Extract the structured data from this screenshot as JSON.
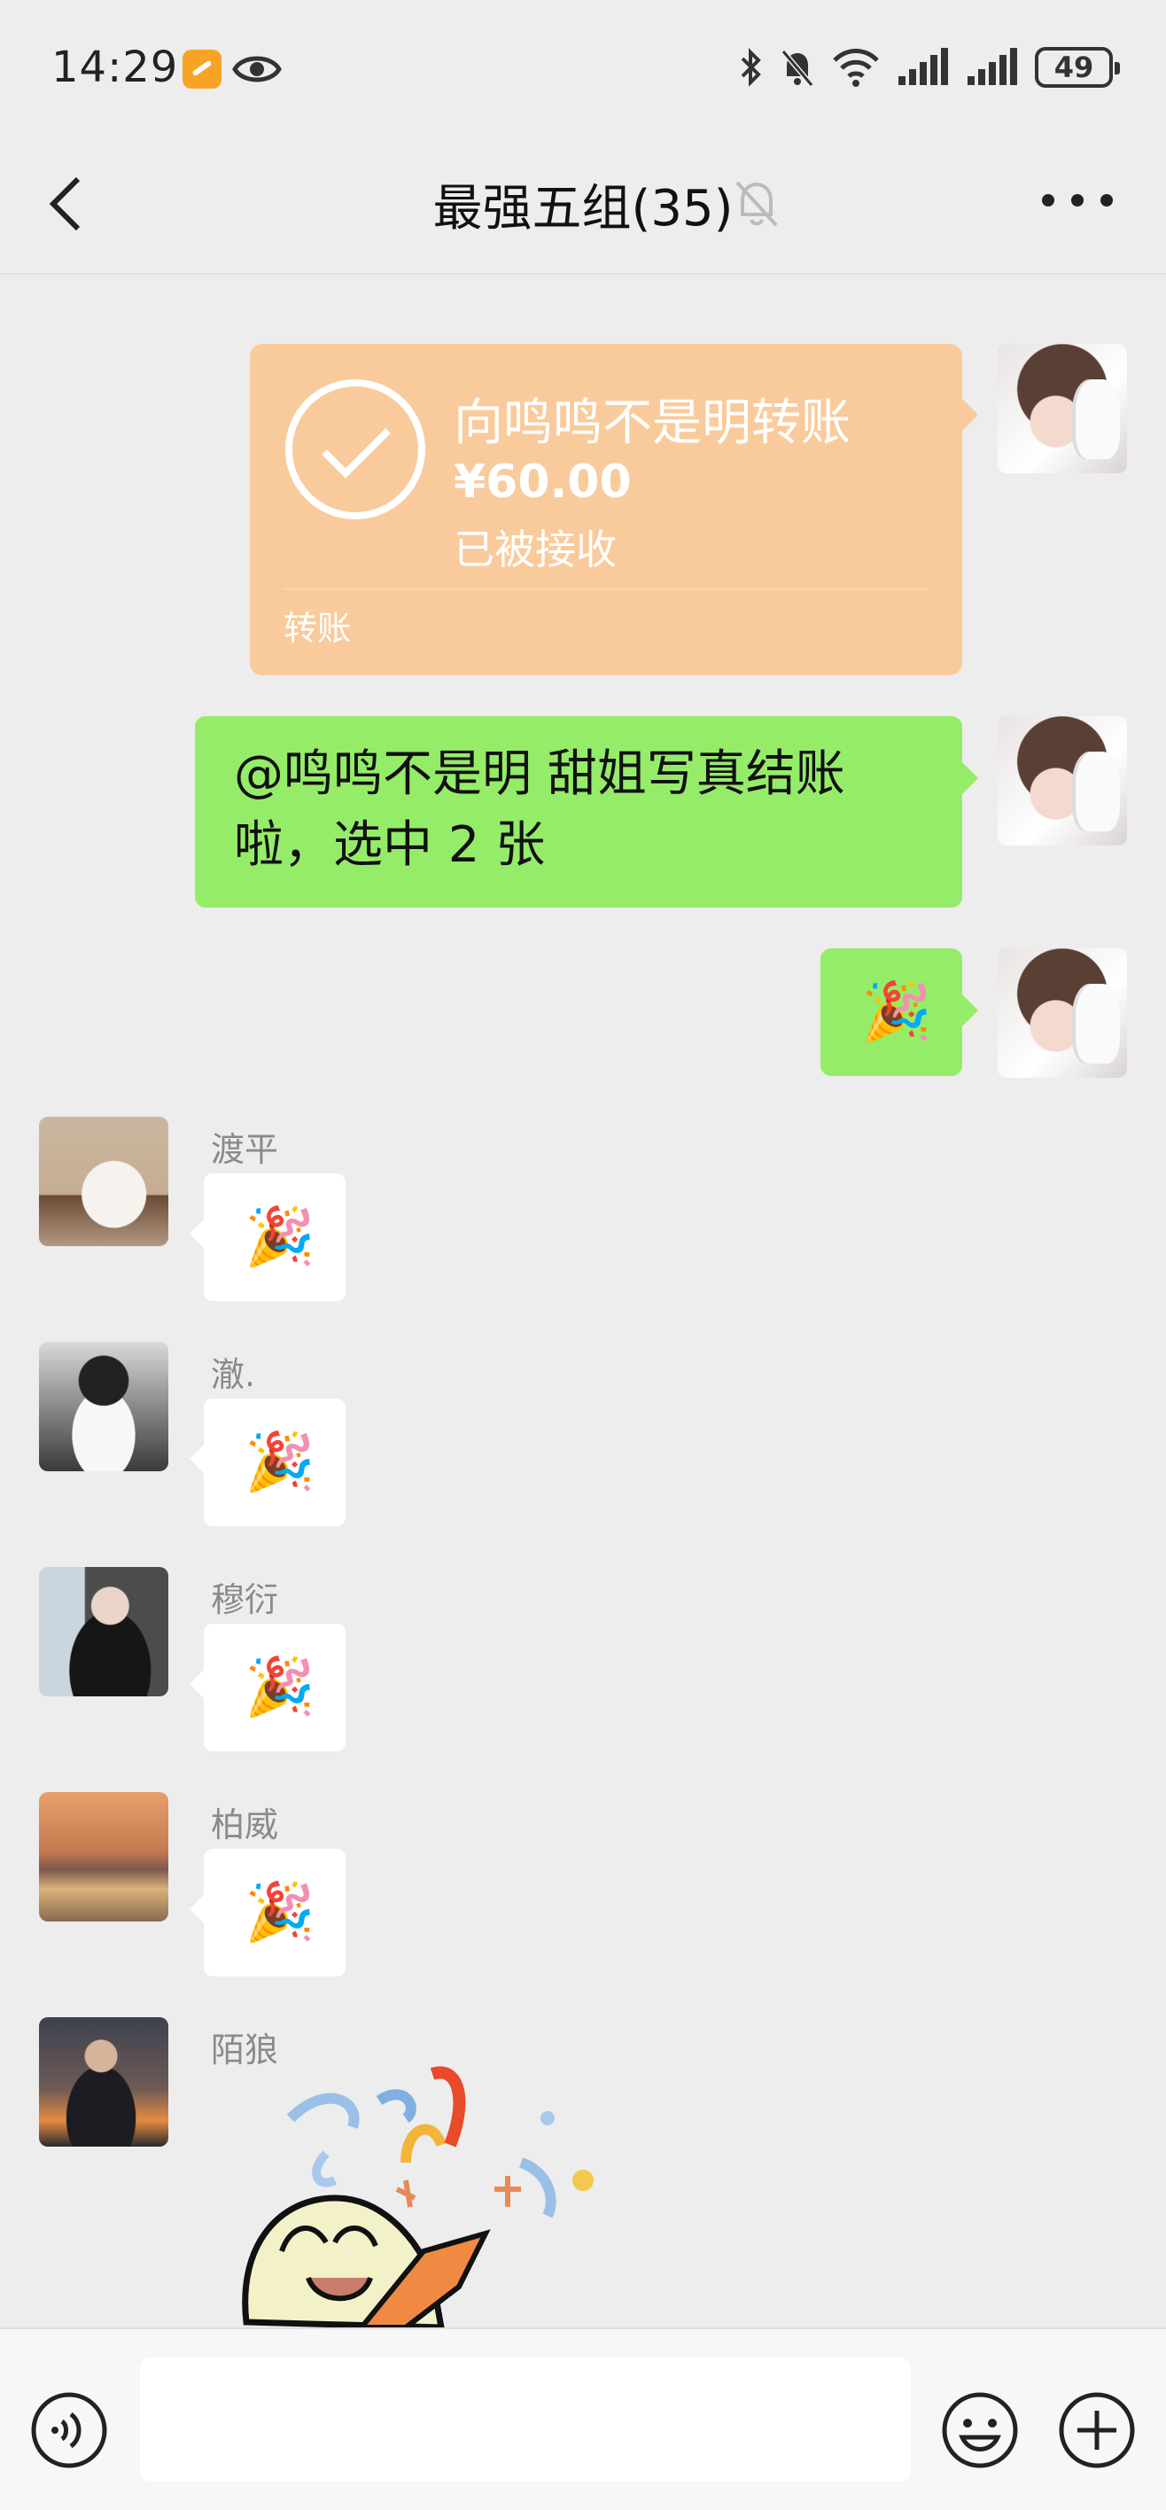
{
  "status_bar": {
    "time": "14:29",
    "battery": "49",
    "icons": [
      "app-notification-icon",
      "eye-icon",
      "bluetooth-icon",
      "mute-bell-icon",
      "wifi-icon",
      "signal-icon",
      "signal-icon",
      "battery-icon"
    ]
  },
  "nav": {
    "title": "最强五组(35)",
    "icons": [
      "back-chevron-icon",
      "muted-bell-icon",
      "more-dots-icon"
    ]
  },
  "messages": {
    "transfer": {
      "title": "向鸣鸣不是明转账",
      "amount": "¥60.00",
      "status": "已被接收",
      "label": "转账",
      "color": "#f9cb9c"
    },
    "text_message": {
      "text": "@鸣鸣不是明 甜姐写真结账啦，选中 2 张",
      "bubble_color": "#95ec69"
    },
    "my_emoji": "🎉",
    "others": [
      {
        "sender": "渡平",
        "emoji": "🎉"
      },
      {
        "sender": "澈.",
        "emoji": "🎉"
      },
      {
        "sender": "穆衍",
        "emoji": "🎉"
      },
      {
        "sender": "柏威",
        "emoji": "🎉"
      },
      {
        "sender": "陌狼",
        "emoji": ""
      }
    ]
  },
  "input_bar": {
    "value": "",
    "icons": [
      "voice-icon",
      "microphone-icon",
      "emoji-icon",
      "plus-icon"
    ]
  },
  "colors": {
    "background": "#ededed",
    "self_bubble": "#95ec69",
    "other_bubble": "#ffffff",
    "transfer": "#f9cb9c"
  }
}
